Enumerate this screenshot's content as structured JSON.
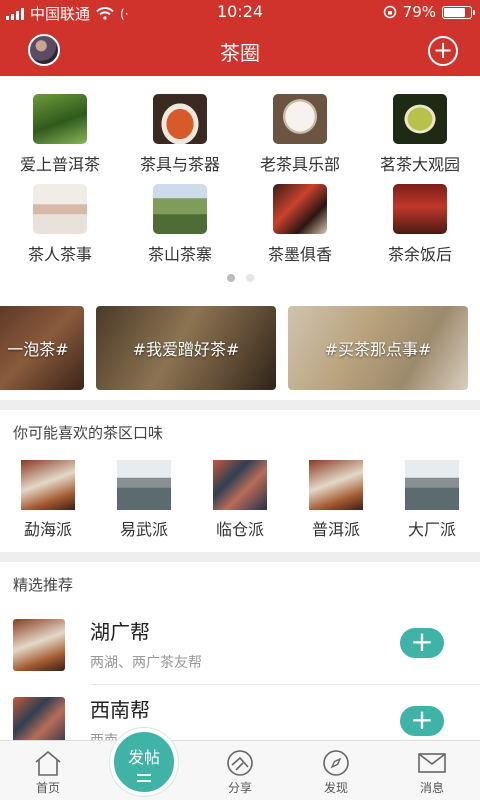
{
  "status_bar": {
    "carrier": "中国联通",
    "time": "10:24",
    "battery": "79%",
    "battery_level": 0.79
  },
  "header": {
    "title": "茶圈",
    "left_icon": "avatar",
    "right_icon": "plus-circle-icon"
  },
  "categories": [
    {
      "label": "爱上普洱茶"
    },
    {
      "label": "茶具与茶器"
    },
    {
      "label": "老茶具乐部"
    },
    {
      "label": "茗茶大观园"
    },
    {
      "label": "茶人茶事"
    },
    {
      "label": "茶山茶寨"
    },
    {
      "label": "茶墨俱香"
    },
    {
      "label": "茶余饭后"
    }
  ],
  "topics": [
    {
      "label": "一泡茶#"
    },
    {
      "label": "#我爱蹭好茶#"
    },
    {
      "label": "#买茶那点事#"
    }
  ],
  "tastes": {
    "title": "你可能喜欢的茶区口味",
    "items": [
      {
        "label": "勐海派"
      },
      {
        "label": "易武派"
      },
      {
        "label": "临仓派"
      },
      {
        "label": "普洱派"
      },
      {
        "label": "大厂派"
      }
    ]
  },
  "recommendations": {
    "title": "精选推荐",
    "items": [
      {
        "name": "湖广帮",
        "desc": "两湖、两广茶友帮"
      },
      {
        "name": "西南帮",
        "desc": "西南"
      }
    ]
  },
  "tabbar": {
    "items": [
      {
        "label": "首页",
        "icon": "home-icon"
      },
      {
        "label": "分享",
        "icon": "share-icon"
      },
      {
        "label": "发现",
        "icon": "compass-icon"
      },
      {
        "label": "消息",
        "icon": "mail-icon"
      }
    ],
    "post_label": "发帖"
  },
  "colors": {
    "brand_red": "#d0332c",
    "accent_teal": "#3fb3a6"
  }
}
